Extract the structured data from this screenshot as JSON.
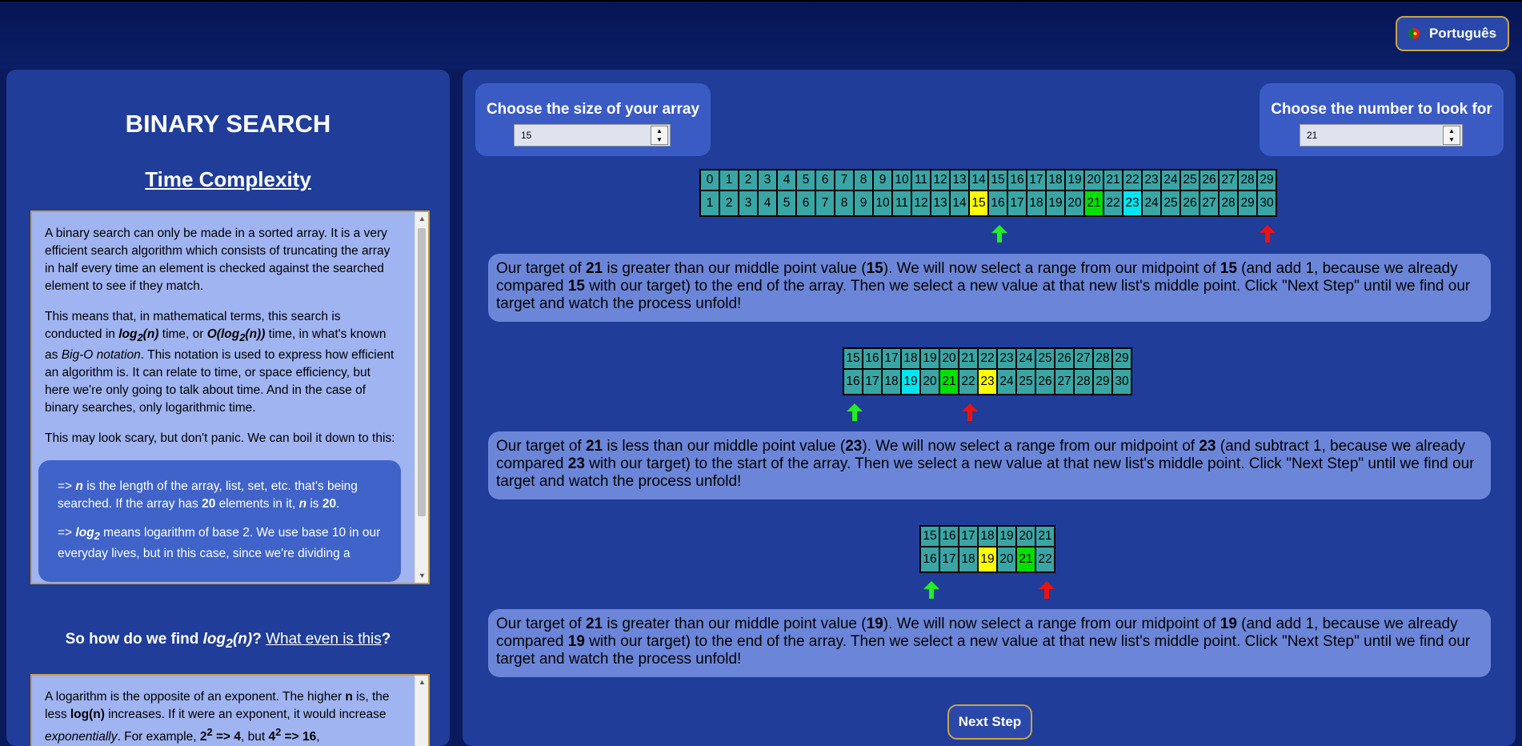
{
  "header": {
    "language_label": "Português",
    "flag_icon": "portugal-flag-icon"
  },
  "left": {
    "title": "BINARY SEARCH",
    "subtitle": "Time Complexity",
    "box1": {
      "p1": "A binary search can only be made in a sorted array. It is a very efficient search algorithm which consists of truncating the array in half every time an element is checked against the searched element to see if they match.",
      "p2_a": "This means that, in mathematical terms, this search is conducted in ",
      "p2_log": "log",
      "p2_sub": "2",
      "p2_n": "(n)",
      "p2_b": " time, or ",
      "p2_o": "O(log",
      "p2_o_sub": "2",
      "p2_o_end": "(n))",
      "p2_c": " time, in what's known as ",
      "p2_bigo": "Big-O notation",
      "p2_d": ". This notation is used to express how efficient an algorithm is. It can relate to time, or space efficiency, but here we're only going to talk about time. And in the case of binary searches, only logarithmic time.",
      "p3": "This may look scary, but don't panic. We can boil it down to this:",
      "b1_a": "=> ",
      "b1_n": "n",
      "b1_b": " is the length of the array, list, set, etc. that's being searched. If the array has ",
      "b1_20": "20",
      "b1_c": " elements in it, ",
      "b1_n2": "n",
      "b1_d": " is ",
      "b1_20b": "20",
      "b1_e": ".",
      "b2_a": "=> ",
      "b2_log": "log",
      "b2_sub": "2",
      "b2_b": " means logarithm of base 2. We use base 10 in our everyday lives, but in this case, since we're dividing a"
    },
    "question_a": "So how do we find ",
    "question_log": "log",
    "question_sub": "2",
    "question_n": "(n)",
    "question_b": "? ",
    "question_link": "What even is this",
    "question_c": "?",
    "box2": {
      "p1_a": "A logarithm is the opposite of an exponent. The higher ",
      "p1_n": "n",
      "p1_b": " is, the less ",
      "p1_logn": "log(n)",
      "p1_c": " increases. If it were an exponent, it would increase ",
      "p1_exp": "exponentially",
      "p1_d": ". For example, ",
      "p1_2": "2",
      "p1_sup1": "2",
      "p1_r1": " => 4",
      "p1_e": ", but ",
      "p1_4": "4",
      "p1_sup2": "2",
      "p1_r2": " => 16",
      "p1_f": ","
    }
  },
  "controls": {
    "size_label": "Choose the size of your array",
    "size_value": "15",
    "target_label": "Choose the number to look for",
    "target_value": "21"
  },
  "arrays": [
    {
      "indices": [
        "0",
        "1",
        "2",
        "3",
        "4",
        "5",
        "6",
        "7",
        "8",
        "9",
        "10",
        "11",
        "12",
        "13",
        "14",
        "15",
        "16",
        "17",
        "18",
        "19",
        "20",
        "21",
        "22",
        "23",
        "24",
        "25",
        "26",
        "27",
        "28",
        "29"
      ],
      "values": [
        "1",
        "2",
        "3",
        "4",
        "5",
        "6",
        "7",
        "8",
        "9",
        "10",
        "11",
        "12",
        "13",
        "14",
        "15",
        "16",
        "17",
        "18",
        "19",
        "20",
        "21",
        "22",
        "23",
        "24",
        "25",
        "26",
        "27",
        "28",
        "29",
        "30"
      ],
      "mid_index": 14,
      "target_index": 20,
      "cyan_index": 22
    },
    {
      "indices": [
        "15",
        "16",
        "17",
        "18",
        "19",
        "20",
        "21",
        "22",
        "23",
        "24",
        "25",
        "26",
        "27",
        "28",
        "29"
      ],
      "values": [
        "16",
        "17",
        "18",
        "19",
        "20",
        "21",
        "22",
        "23",
        "24",
        "25",
        "26",
        "27",
        "28",
        "29",
        "30"
      ],
      "mid_index": 7,
      "target_index": 5,
      "cyan_index": 3
    },
    {
      "indices": [
        "15",
        "16",
        "17",
        "18",
        "19",
        "20",
        "21"
      ],
      "values": [
        "16",
        "17",
        "18",
        "19",
        "20",
        "21",
        "22"
      ],
      "mid_index": 3,
      "target_index": 5,
      "cyan_index": -1
    }
  ],
  "messages": [
    {
      "a": "Our target of ",
      "t": "21",
      "b": " is greater than our middle point value (",
      "m": "15",
      "c": "). We will now select a range from our midpoint of ",
      "m2": "15",
      "d": " (and add 1, because we already compared ",
      "m3": "15",
      "e": " with our target) to the end of the array. Then we select a new value at that new list's middle point. Click \"Next Step\" until we find our target and watch the process unfold!"
    },
    {
      "a": "Our target of ",
      "t": "21",
      "b": " is less than our middle point value (",
      "m": "23",
      "c": "). We will now select a range from our midpoint of ",
      "m2": "23",
      "d": " (and subtract 1, because we already compared ",
      "m3": "23",
      "e": " with our target) to the start of the array. Then we select a new value at that new list's middle point. Click \"Next Step\" until we find our target and watch the process unfold!"
    },
    {
      "a": "Our target of ",
      "t": "21",
      "b": " is greater than our middle point value (",
      "m": "19",
      "c": "). We will now select a range from our midpoint of ",
      "m2": "19",
      "d": " (and add 1, because we already compared ",
      "m3": "19",
      "e": " with our target) to the end of the array. Then we select a new value at that new list's middle point. Click \"Next Step\" until we find our target and watch the process unfold!"
    }
  ],
  "next_step_label": "Next Step",
  "colors": {
    "cell": "#3aa5a5",
    "mid": "#ffff00",
    "target": "#00e000",
    "cyan": "#00e5f0",
    "start_arrow": "#22ee22",
    "end_arrow": "#ee1111"
  }
}
